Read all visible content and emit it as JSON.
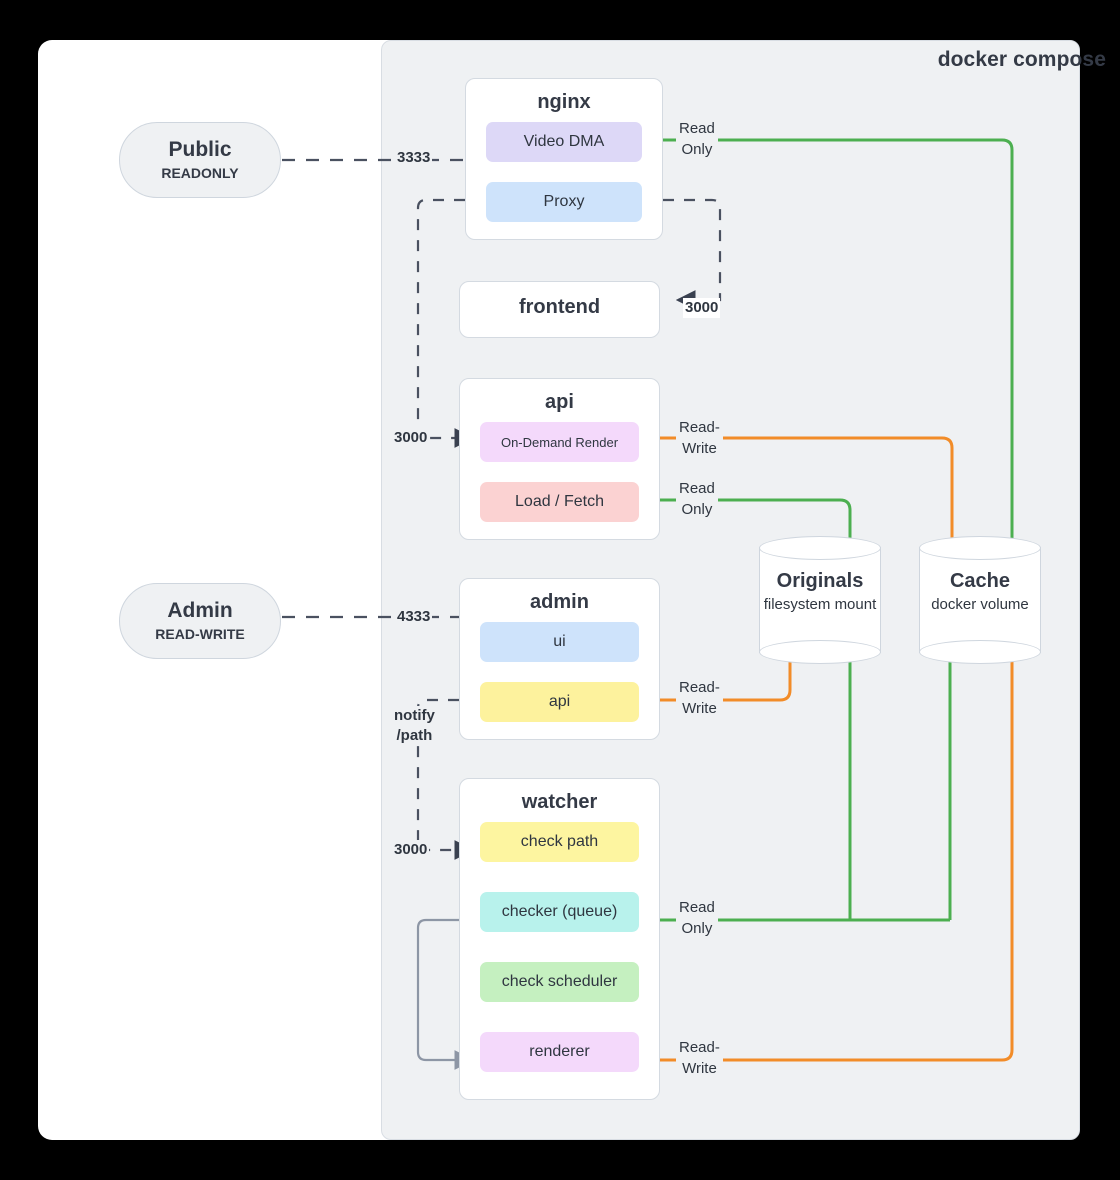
{
  "panel": {
    "title": "docker compose"
  },
  "actors": [
    {
      "id": "public",
      "name": "Public",
      "access": "READONLY"
    },
    {
      "id": "admin",
      "name": "Admin",
      "access": "READ-WRITE"
    }
  ],
  "services": [
    {
      "id": "nginx",
      "title": "nginx",
      "boxes": [
        {
          "label": "Video DMA",
          "color": "#ddd8f7"
        },
        {
          "label": "Proxy",
          "color": "#cee3fb"
        }
      ]
    },
    {
      "id": "frontend",
      "title": "frontend",
      "boxes": []
    },
    {
      "id": "api",
      "title": "api",
      "boxes": [
        {
          "label": "On-Demand Render",
          "color": "#f4d9fb"
        },
        {
          "label": "Load / Fetch",
          "color": "#fbd2d2"
        }
      ]
    },
    {
      "id": "admin",
      "title": "admin",
      "boxes": [
        {
          "label": "ui",
          "color": "#cee3fb"
        },
        {
          "label": "api",
          "color": "#fdf29d"
        }
      ]
    },
    {
      "id": "watcher",
      "title": "watcher",
      "boxes": [
        {
          "label": "check path",
          "color": "#fdf5a0"
        },
        {
          "label": "checker (queue)",
          "color": "#b8f2ec"
        },
        {
          "label": "check scheduler",
          "color": "#c5f0c0"
        },
        {
          "label": "renderer",
          "color": "#f4d9fb"
        }
      ]
    }
  ],
  "stores": [
    {
      "id": "originals",
      "name": "Originals",
      "kind": "filesystem\nmount"
    },
    {
      "id": "cache",
      "name": "Cache",
      "kind": "docker\nvolume"
    }
  ],
  "ports": {
    "public_nginx": "3333",
    "admin_service": "4333",
    "proxy_frontend": "3000",
    "proxy_api": "3000",
    "notify_path": "notify\n/path",
    "watcher_port": "3000"
  },
  "access_labels": {
    "video_dma_originals": "Read\nOnly",
    "api_render_cache": "Read-\nWrite",
    "api_load_originals": "Read\nOnly",
    "admin_api_originals": "Read-\nWrite",
    "checker_stores": "Read\nOnly",
    "renderer_cache": "Read-\nWrite"
  },
  "colors": {
    "read_only": "#4caf50",
    "read_write": "#f28c28",
    "dashed": "#4a5160",
    "internal_arrow": "#3a4150",
    "loop_arrow": "#8d96a5"
  }
}
